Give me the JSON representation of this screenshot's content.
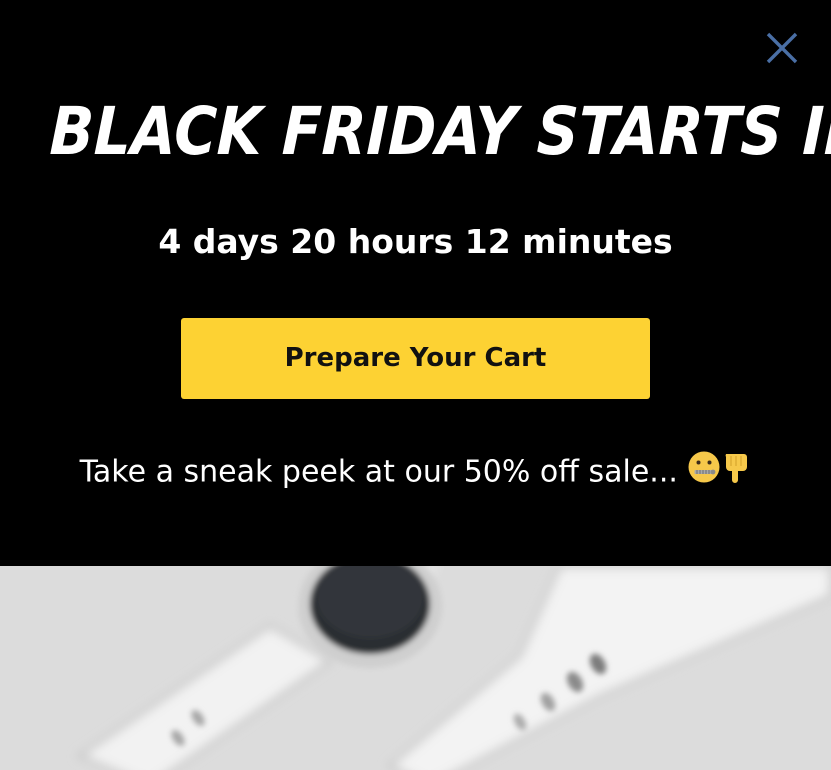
{
  "popup": {
    "headline": "BLACK FRIDAY STARTS IN...",
    "countdown": "4 days 20 hours 12 minutes",
    "cta_label": "Prepare Your Cart",
    "subtext": "Take a sneak peek at our 50% off sale... ",
    "emojis": [
      "zipper-mouth-face",
      "backhand-index-pointing-down"
    ],
    "close_icon": "close-icon",
    "colors": {
      "background": "#000000",
      "cta_background": "#fdd233",
      "close_icon": "#4a6fa5",
      "text": "#ffffff"
    }
  },
  "hero_image": {
    "subject": "white smartwatches (blurred product photo)"
  }
}
